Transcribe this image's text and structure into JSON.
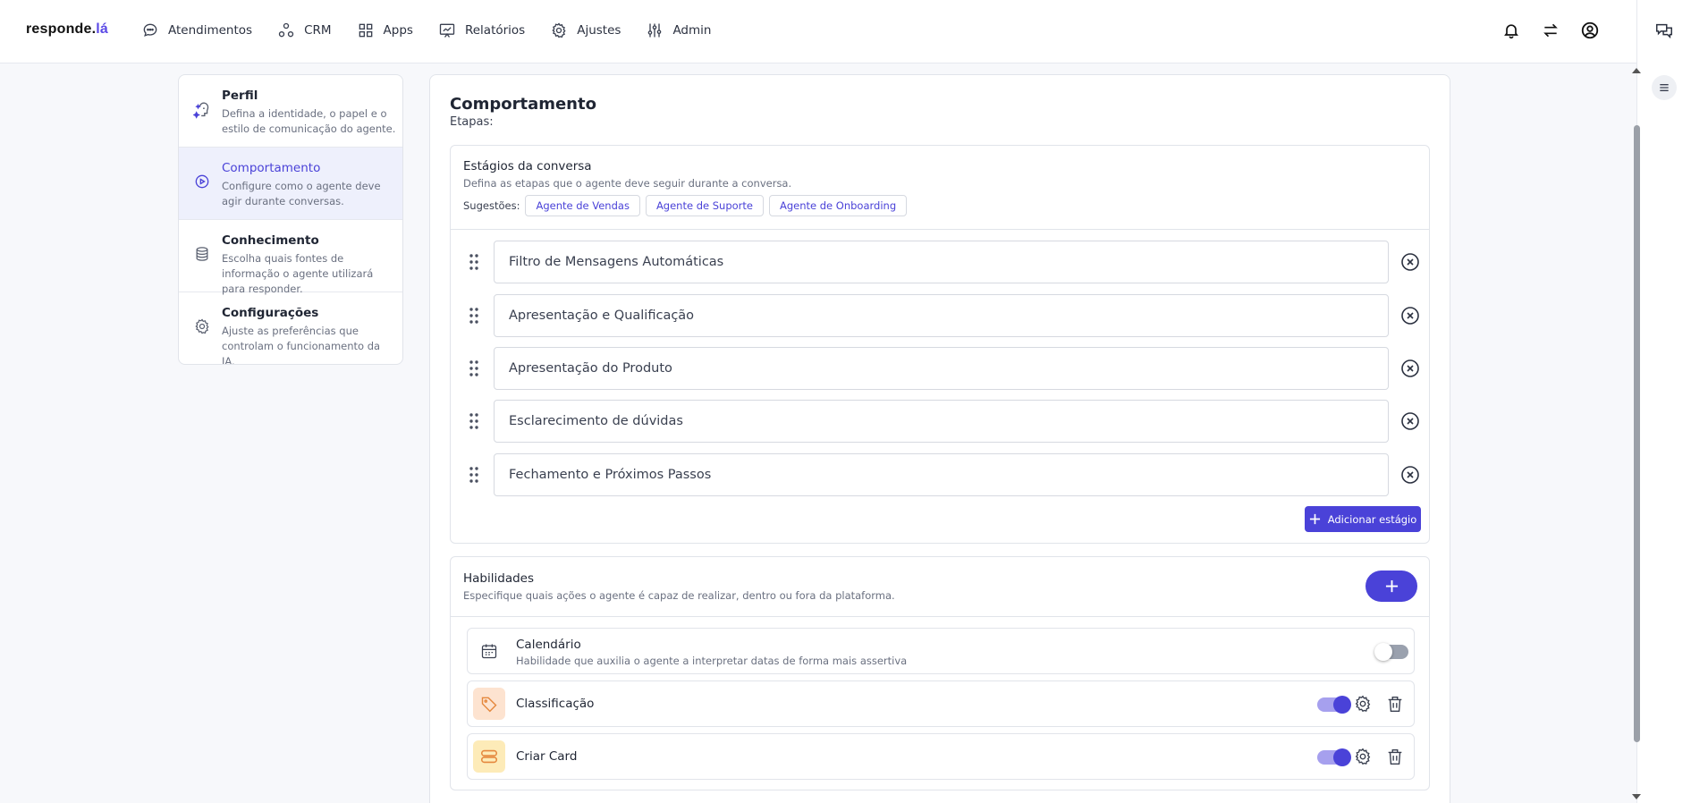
{
  "brand": {
    "name": "responde.",
    "accent": "lá"
  },
  "nav": [
    {
      "label": "Atendimentos",
      "icon": "chat-bubble-icon"
    },
    {
      "label": "CRM",
      "icon": "nodes-icon"
    },
    {
      "label": "Apps",
      "icon": "grid-icon"
    },
    {
      "label": "Relatórios",
      "icon": "chart-board-icon"
    },
    {
      "label": "Ajustes",
      "icon": "gear-icon"
    },
    {
      "label": "Admin",
      "icon": "sliders-icon"
    }
  ],
  "sidebar": {
    "items": [
      {
        "title": "Perfil",
        "desc": "Defina a identidade, o papel e o estilo de comunicação do agente.",
        "icon": "agent-sparkle-icon",
        "active": false
      },
      {
        "title": "Comportamento",
        "desc": "Configure como o agente deve agir durante conversas.",
        "icon": "play-circle-icon",
        "active": true
      },
      {
        "title": "Conhecimento",
        "desc": "Escolha quais fontes de informação o agente utilizará para responder.",
        "icon": "database-icon",
        "active": false
      },
      {
        "title": "Configurações",
        "desc": "Ajuste as preferências que controlam o funcionamento da IA.",
        "icon": "gear-icon",
        "active": false
      }
    ]
  },
  "main": {
    "title": "Comportamento",
    "subtitle": "Etapas:",
    "stages": {
      "title": "Estágios da conversa",
      "desc": "Defina as etapas que o agente deve seguir durante a conversa.",
      "suggestions_label": "Sugestões:",
      "suggestions": [
        "Agente de Vendas",
        "Agente de Suporte",
        "Agente de Onboarding"
      ],
      "items": [
        "Filtro de Mensagens Automáticas",
        "Apresentação e Qualificação",
        "Apresentação do Produto",
        "Esclarecimento de dúvidas",
        "Fechamento e Próximos Passos"
      ],
      "add_label": "Adicionar estágio"
    },
    "skills": {
      "title": "Habilidades",
      "desc": "Especifique quais ações o agente é capaz de realizar, dentro ou fora da plataforma.",
      "items": [
        {
          "name": "Calendário",
          "desc": "Habilidade que auxilia o agente a interpretar datas de forma mais assertiva",
          "enabled": false,
          "icon": "calendar-icon",
          "icon_bg": "#ffffff"
        },
        {
          "name": "Classificação",
          "desc": "",
          "enabled": true,
          "icon": "tag-icon",
          "icon_bg": "#fde3d0"
        },
        {
          "name": "Criar Card",
          "desc": "",
          "enabled": true,
          "icon": "card-stack-icon",
          "icon_bg": "#fdebb8"
        }
      ]
    }
  },
  "colors": {
    "accent": "#4a42d8",
    "active_bg": "#eef0fc",
    "border": "#e1e4ea"
  }
}
